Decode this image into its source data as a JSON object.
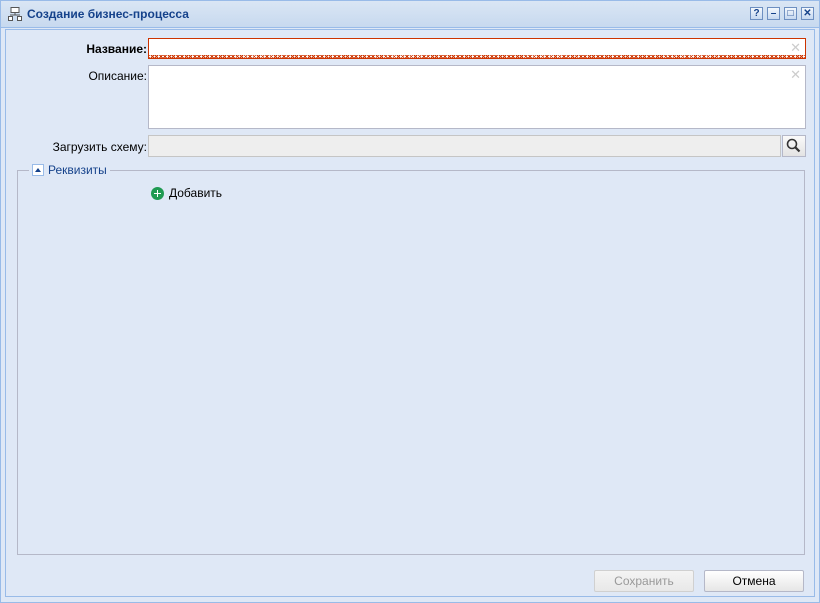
{
  "window": {
    "title": "Создание бизнес-процесса",
    "icon": "network-icon",
    "tools": [
      "?",
      "–",
      "□",
      "✕"
    ]
  },
  "form": {
    "name_label": "Название:",
    "name_value": "",
    "description_label": "Описание:",
    "description_value": "",
    "schema_label": "Загрузить схему:",
    "schema_value": ""
  },
  "fieldset": {
    "title": "Реквизиты",
    "add_label": "Добавить"
  },
  "footer": {
    "save_label": "Сохранить",
    "cancel_label": "Отмена"
  },
  "colors": {
    "accent": "#15428b",
    "border": "#99bbe8",
    "background": "#dfe8f6",
    "invalid": "#cc3300",
    "add_green": "#1f9a52"
  }
}
